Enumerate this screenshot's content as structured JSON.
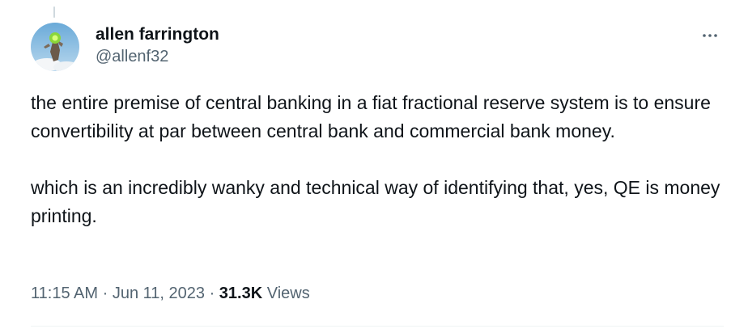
{
  "author": {
    "display_name": "allen farrington",
    "handle": "@allenf32",
    "avatar_icon": "avatar-image"
  },
  "tweet": {
    "paragraphs": [
      "the entire premise of central banking in a fiat fractional reserve system is to ensure convertibility at par between central bank and commercial bank money.",
      "which is an incredibly wanky and technical way of identifying that, yes, QE is money printing."
    ],
    "time": "11:15 AM",
    "separator": "·",
    "date": "Jun 11, 2023",
    "views_count": "31.3K",
    "views_label": "Views"
  },
  "more_icon": "more-horizontal-icon",
  "colors": {
    "text_primary": "#0f1419",
    "text_secondary": "#536471",
    "divider": "#eff3f4"
  }
}
